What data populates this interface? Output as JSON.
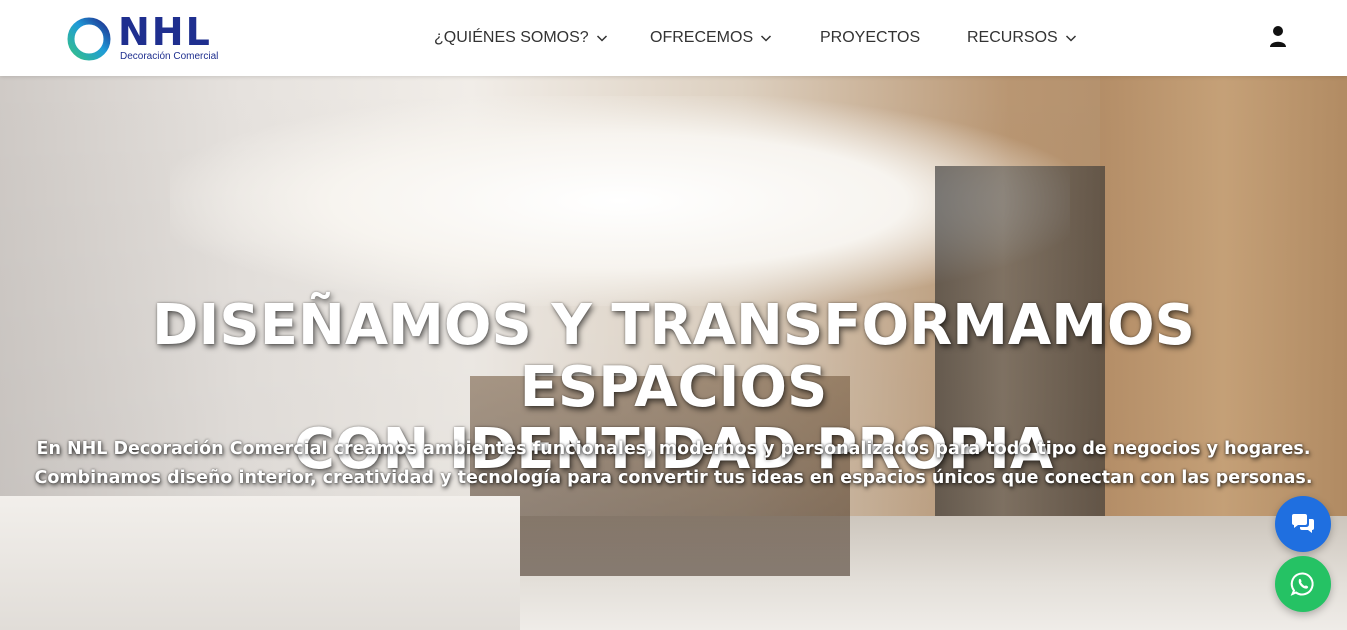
{
  "brand": {
    "logo_text": "NHL",
    "tagline": "Decoración Comercial",
    "colors": {
      "primary": "#1f2f8f",
      "accent_green": "#35c08a",
      "accent_blue": "#1f9bd8"
    }
  },
  "nav": {
    "items": [
      {
        "label": "¿QUIÉNES SOMOS?",
        "has_dropdown": true
      },
      {
        "label": "OFRECEMOS",
        "has_dropdown": true
      },
      {
        "label": "PROYECTOS",
        "has_dropdown": false
      },
      {
        "label": "RECURSOS",
        "has_dropdown": true
      }
    ],
    "user_icon": "user-icon"
  },
  "hero": {
    "title_line1": "DISEÑAMOS Y TRANSFORMAMOS ESPACIOS",
    "title_line2": "CON IDENTIDAD PROPIA",
    "subtitle_line1": "En NHL Decoración Comercial creamos ambientes funcionales, modernos y personalizados para todo tipo de negocios y hogares.",
    "subtitle_line2": "Combinamos diseño interior, creatividad y tecnología para convertir tus ideas en espacios únicos que conectan con las personas.",
    "background": "hotel-lobby-interior"
  },
  "floating": {
    "chat": {
      "icon": "chat-bubbles-icon",
      "color": "#1f6fe0"
    },
    "whatsapp": {
      "icon": "whatsapp-icon",
      "color": "#25c264"
    }
  }
}
